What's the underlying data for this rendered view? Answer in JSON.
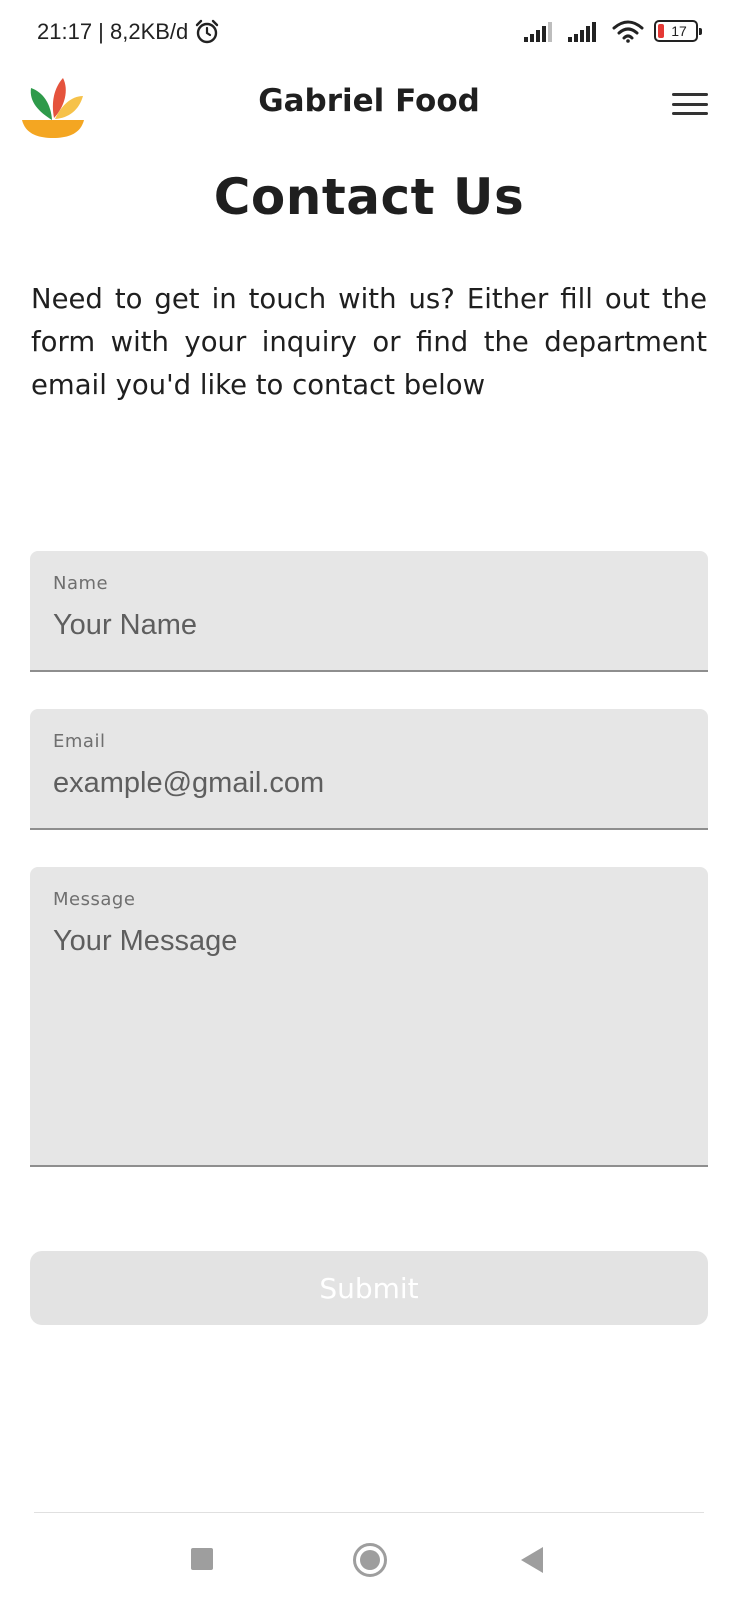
{
  "status_bar": {
    "time_speed": "21:17 | 8,2KB/d",
    "battery_level": "17",
    "battery_fraction": 0.17,
    "icons": [
      "alarm-icon",
      "signal-icon",
      "signal-icon",
      "wifi-icon",
      "battery-icon"
    ]
  },
  "app_bar": {
    "title": "Gabriel Food",
    "menu_icon": "hamburger-menu-icon",
    "logo_icon": "food-bowl-logo"
  },
  "page": {
    "title": "Contact Us",
    "intro": "Need to get in touch with us? Either fill out the form with your inquiry or find the department email you'd like to contact below"
  },
  "form": {
    "name": {
      "label": "Name",
      "placeholder": "Your Name"
    },
    "email": {
      "label": "Email",
      "placeholder": "example@gmail.com"
    },
    "message": {
      "label": "Message",
      "placeholder": "Your Message"
    },
    "submit_label": "Submit"
  },
  "nav_bar": {
    "icons": [
      "recent-apps-icon",
      "home-icon",
      "back-icon"
    ]
  },
  "colors": {
    "field_bg": "#e6e6e6",
    "button_bg": "#e3e3e3",
    "logo_orange": "#f4a622",
    "logo_green": "#2e9a4a",
    "logo_red": "#e5533d"
  }
}
